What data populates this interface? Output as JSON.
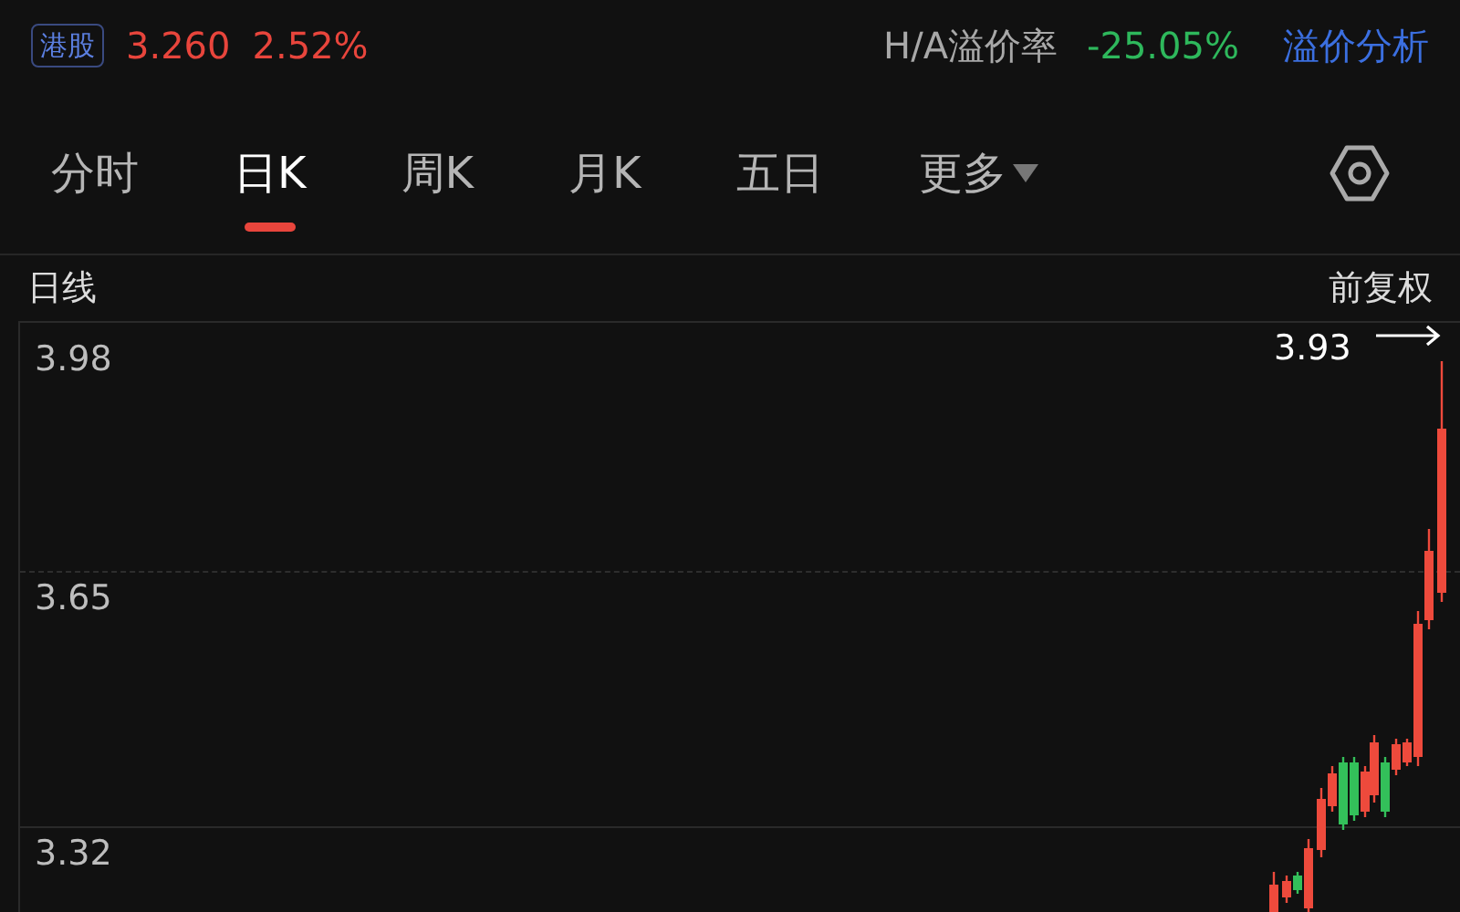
{
  "header": {
    "market_badge": "港股",
    "price": "3.260",
    "change": "2.52%",
    "premium_label": "H/A溢价率",
    "premium_value": "-25.05%",
    "premium_link": "溢价分析"
  },
  "tabs": [
    {
      "label": "分时",
      "selected": false,
      "kind": "plain"
    },
    {
      "label": "日K",
      "selected": true,
      "kind": "plain"
    },
    {
      "label": "周K",
      "selected": false,
      "kind": "plain"
    },
    {
      "label": "月K",
      "selected": false,
      "kind": "plain"
    },
    {
      "label": "五日",
      "selected": false,
      "kind": "plain"
    },
    {
      "label": "更多",
      "selected": false,
      "kind": "dropdown"
    }
  ],
  "chart": {
    "title": "日线",
    "adjustment": "前复权",
    "y_labels": [
      "3.98",
      "3.65",
      "3.32"
    ],
    "max_label": "3.93"
  }
}
